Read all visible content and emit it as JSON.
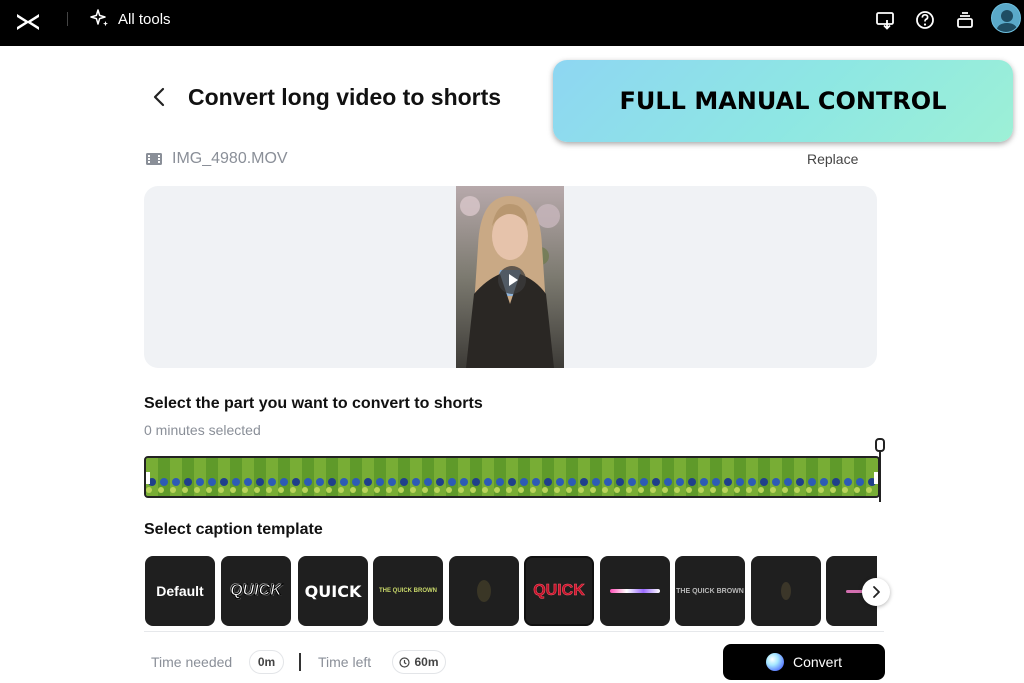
{
  "topbar": {
    "all_tools_label": "All tools",
    "icons": [
      "logo-icon",
      "sparkle-icon",
      "download-icon",
      "help-icon",
      "layers-icon",
      "avatar"
    ]
  },
  "page": {
    "title": "Convert long video to shorts"
  },
  "banner": {
    "text": "FULL MANUAL CONTROL"
  },
  "file": {
    "name": "IMG_4980.MOV",
    "replace_label": "Replace"
  },
  "selection": {
    "label": "Select the part you want to convert to shorts",
    "minutes_selected": "0 minutes selected"
  },
  "captions": {
    "label": "Select caption template",
    "templates": [
      {
        "label": "Default",
        "selected": false
      },
      {
        "label": "QUICK",
        "selected": false
      },
      {
        "label": "QUICK",
        "selected": false
      },
      {
        "label": "THE QUICK BROWN",
        "selected": false
      },
      {
        "label": "",
        "selected": false
      },
      {
        "label": "QUICK",
        "selected": true
      },
      {
        "label": "",
        "selected": false
      },
      {
        "label": "THE QUICK BROWN",
        "selected": false
      },
      {
        "label": "",
        "selected": false
      },
      {
        "label": "",
        "selected": false
      }
    ]
  },
  "footer": {
    "time_needed_label": "Time needed",
    "time_needed_value": "0m",
    "time_left_label": "Time left",
    "time_left_value": "60m",
    "convert_label": "Convert"
  },
  "colors": {
    "topbar": "#000000",
    "banner_start": "#8ed6f2",
    "banner_end": "#9df0d6",
    "convert_button": "#000000"
  }
}
